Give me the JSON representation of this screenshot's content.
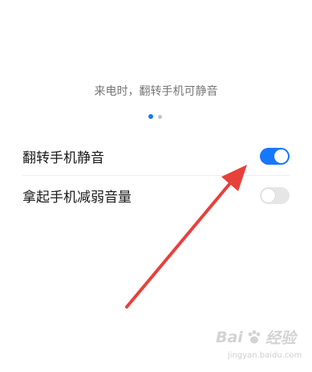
{
  "caption": "来电时，翻转手机可静音",
  "pager": {
    "total": 2,
    "active": 1
  },
  "settings": [
    {
      "label": "翻转手机静音",
      "enabled": true
    },
    {
      "label": "拿起手机减弱音量",
      "enabled": false
    }
  ],
  "colors": {
    "accent": "#1677ff",
    "switch_off": "#e6e6e6",
    "arrow": "#e8403b"
  },
  "watermark": {
    "brand": "Bai",
    "brand2": "经验",
    "site": "jingyan.baidu.com"
  }
}
